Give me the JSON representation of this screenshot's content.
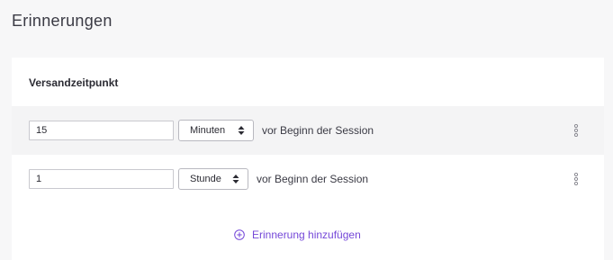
{
  "page": {
    "title": "Erinnerungen"
  },
  "reminders": {
    "section_label": "Versandzeitpunkt",
    "rows": [
      {
        "amount": "15",
        "unit": "Minuten",
        "suffix": "vor Beginn der Session"
      },
      {
        "amount": "1",
        "unit": "Stunde",
        "suffix": "vor Beginn der Session"
      }
    ],
    "add_label": "Erinnerung hinzufügen"
  },
  "colors": {
    "accent": "#7447d8",
    "page_bg": "#f7f7f8",
    "row_highlight": "#f4f4f5"
  },
  "icons": {
    "select_arrows": "updown-icon",
    "row_menu": "more-vertical-icon",
    "add": "plus-circle-icon"
  }
}
